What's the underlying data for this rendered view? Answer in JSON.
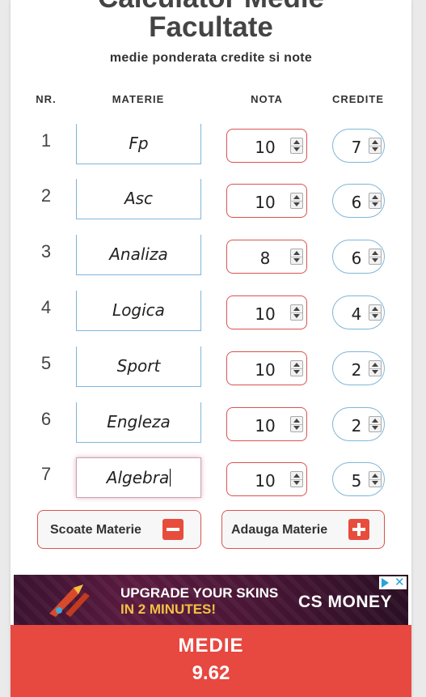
{
  "header": {
    "title_line1": "Calculator Medie",
    "title_line2": "Facultate",
    "subtitle": "medie ponderata credite si note"
  },
  "columns": {
    "nr": "NR.",
    "materie": "MATERIE",
    "nota": "NOTA",
    "credite": "CREDITE"
  },
  "rows": [
    {
      "nr": "1",
      "materie": "Fp",
      "nota": "10",
      "credite": "7"
    },
    {
      "nr": "2",
      "materie": "Asc",
      "nota": "10",
      "credite": "6"
    },
    {
      "nr": "3",
      "materie": "Analiza",
      "nota": "8",
      "credite": "6"
    },
    {
      "nr": "4",
      "materie": "Logica",
      "nota": "10",
      "credite": "4"
    },
    {
      "nr": "5",
      "materie": "Sport",
      "nota": "10",
      "credite": "2"
    },
    {
      "nr": "6",
      "materie": "Engleza",
      "nota": "10",
      "credite": "2"
    },
    {
      "nr": "7",
      "materie": "Algebra",
      "nota": "10",
      "credite": "5"
    }
  ],
  "buttons": {
    "remove_label": "Scoate Materie",
    "add_label": "Adauga Materie"
  },
  "ad": {
    "line1": "UPGRADE YOUR SKINS",
    "line2": "IN 2 MINUTES!",
    "brand": "CS MONEY"
  },
  "result": {
    "label": "MEDIE",
    "value": "9.62"
  },
  "colors": {
    "accent_red": "#e74840",
    "border_blue": "#7fb6d9"
  }
}
